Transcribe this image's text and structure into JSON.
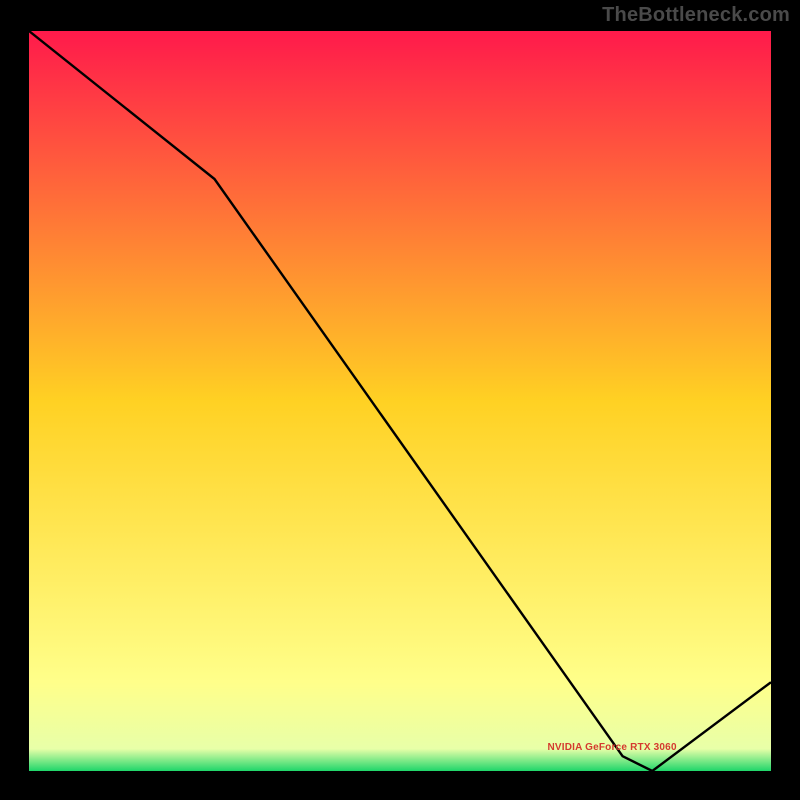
{
  "watermark": "TheBottleneck.com",
  "annotation_label": "NVIDIA GeForce RTX 3060",
  "colors": {
    "top": "#ff1a4b",
    "mid": "#ffd123",
    "nearBottom": "#ffff8a",
    "bottom": "#1fd66a",
    "line": "#000000",
    "annotation": "#d43a2f"
  },
  "chart_data": {
    "type": "line",
    "title": "",
    "xlabel": "",
    "ylabel": "",
    "xlim": [
      0,
      100
    ],
    "ylim": [
      0,
      100
    ],
    "grid": false,
    "legend": false,
    "x": [
      0,
      25,
      80,
      84,
      100
    ],
    "values": [
      100,
      80,
      2,
      0,
      12
    ],
    "annotations": [
      {
        "text": "NVIDIA GeForce RTX 3060",
        "x": 82,
        "y": 2
      }
    ],
    "note": "x and y are in percent of the plot interior; values decrease from top-left, hit a minimum near x≈84, then rise."
  }
}
